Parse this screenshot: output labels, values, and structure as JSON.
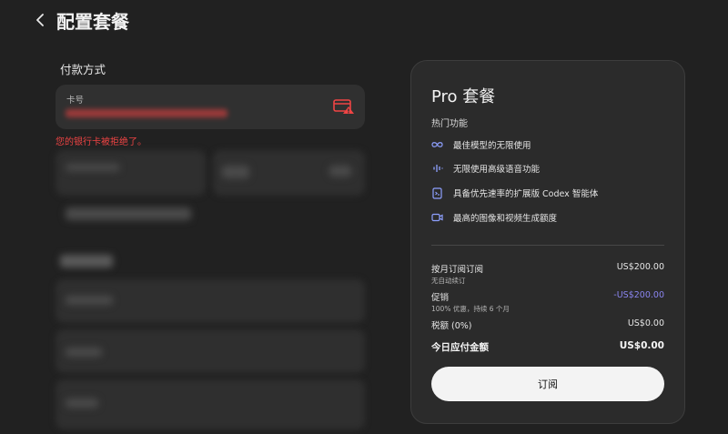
{
  "header": {
    "title": "配置套餐"
  },
  "payment": {
    "section_label": "付款方式",
    "card_label": "卡号",
    "error": "您的银行卡被拒绝了。"
  },
  "plan": {
    "title": "Pro 套餐",
    "features_heading": "热门功能",
    "features": [
      {
        "icon": "infinity-icon",
        "label": "最佳模型的无限使用"
      },
      {
        "icon": "waveform-icon",
        "label": "无限使用高级语音功能"
      },
      {
        "icon": "codex-icon",
        "label": "具备优先速率的扩展版 Codex 智能体"
      },
      {
        "icon": "video-icon",
        "label": "最高的图像和视频生成额度"
      }
    ],
    "monthly_label": "按月订阅订阅",
    "monthly_value": "US$200.00",
    "monthly_note": "无自动续订",
    "promo_label": "促销",
    "promo_value": "-US$200.00",
    "promo_note": "100% 优惠，持续 6 个月",
    "tax_label": "税额 (0%)",
    "tax_value": "US$0.00",
    "total_label": "今日应付金额",
    "total_value": "US$0.00",
    "subscribe_label": "订阅"
  },
  "colors": {
    "accent_promo": "#8a85f0",
    "error": "#ef4444",
    "background": "#212121"
  }
}
